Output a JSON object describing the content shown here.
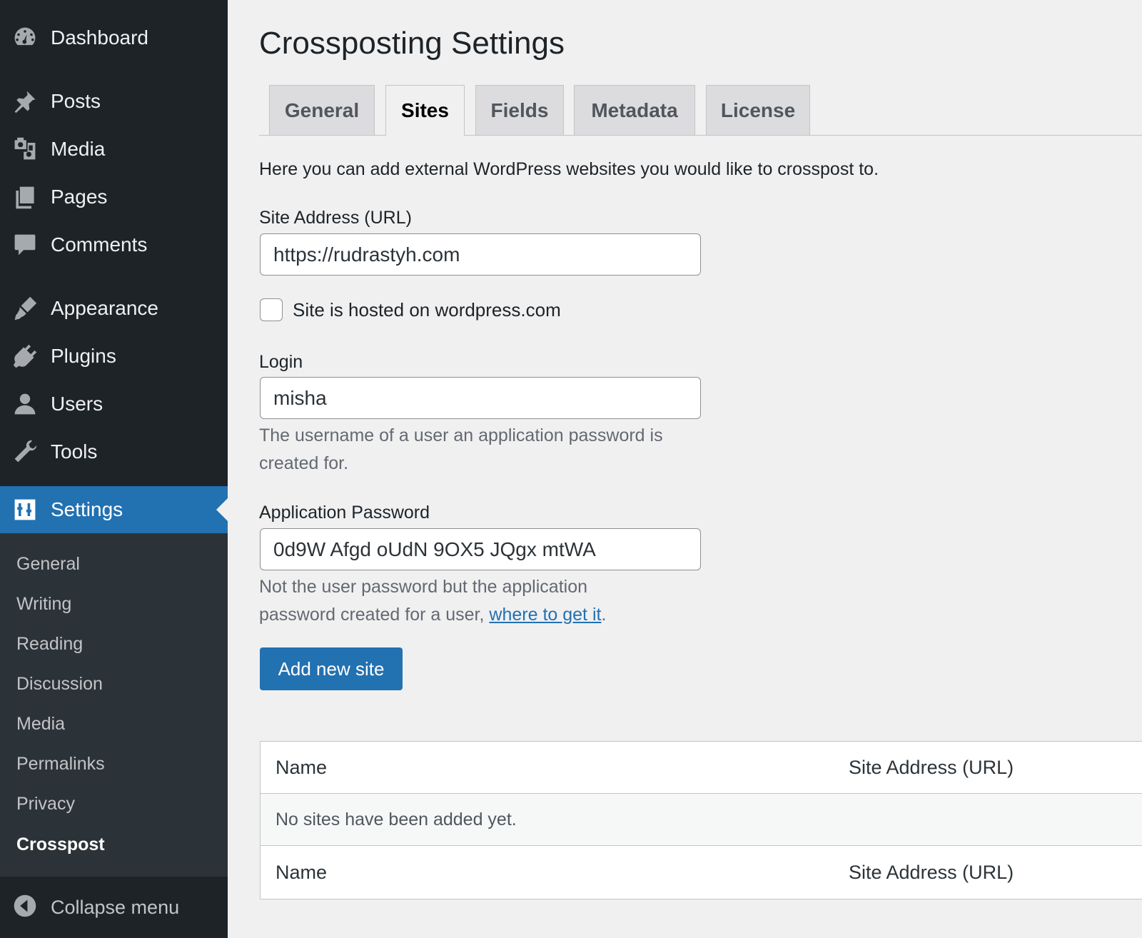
{
  "sidebar": {
    "items": [
      {
        "label": "Dashboard",
        "icon": "dashboard-icon"
      },
      {
        "label": "Posts",
        "icon": "pin-icon"
      },
      {
        "label": "Media",
        "icon": "media-icon"
      },
      {
        "label": "Pages",
        "icon": "pages-icon"
      },
      {
        "label": "Comments",
        "icon": "comment-icon"
      },
      {
        "label": "Appearance",
        "icon": "brush-icon"
      },
      {
        "label": "Plugins",
        "icon": "plug-icon"
      },
      {
        "label": "Users",
        "icon": "user-icon"
      },
      {
        "label": "Tools",
        "icon": "wrench-icon"
      },
      {
        "label": "Settings",
        "icon": "settings-icon",
        "current": true
      }
    ],
    "submenu": [
      "General",
      "Writing",
      "Reading",
      "Discussion",
      "Media",
      "Permalinks",
      "Privacy",
      "Crosspost"
    ],
    "submenu_active": "Crosspost",
    "collapse_label": "Collapse menu"
  },
  "page": {
    "title": "Crossposting Settings",
    "tabs": [
      "General",
      "Sites",
      "Fields",
      "Metadata",
      "License"
    ],
    "active_tab": "Sites",
    "intro": "Here you can add external WordPress websites you would like to crosspost to."
  },
  "form": {
    "url_label": "Site Address (URL)",
    "url_value": "https://rudrastyh.com",
    "wpcom_label": "Site is hosted on wordpress.com",
    "wpcom_checked": false,
    "login_label": "Login",
    "login_value": "misha",
    "login_desc": "The username of a user an application password is created for.",
    "password_label": "Application Password",
    "password_value": "0d9W Afgd oUdN 9OX5 JQgx mtWA",
    "password_desc_1": "Not the user password but the application password created for a user,",
    "password_link": "where to get it",
    "password_desc_end": ".",
    "add_button": "Add new site"
  },
  "table": {
    "columns": [
      "Name",
      "Site Address (URL)"
    ],
    "empty_message": "No sites have been added yet.",
    "footer_columns": [
      "Name",
      "Site Address (URL)"
    ]
  },
  "colors": {
    "sidebar_bg": "#1d2327",
    "submenu_bg": "#2c3338",
    "accent": "#2271b1",
    "page_bg": "#f0f0f1"
  }
}
